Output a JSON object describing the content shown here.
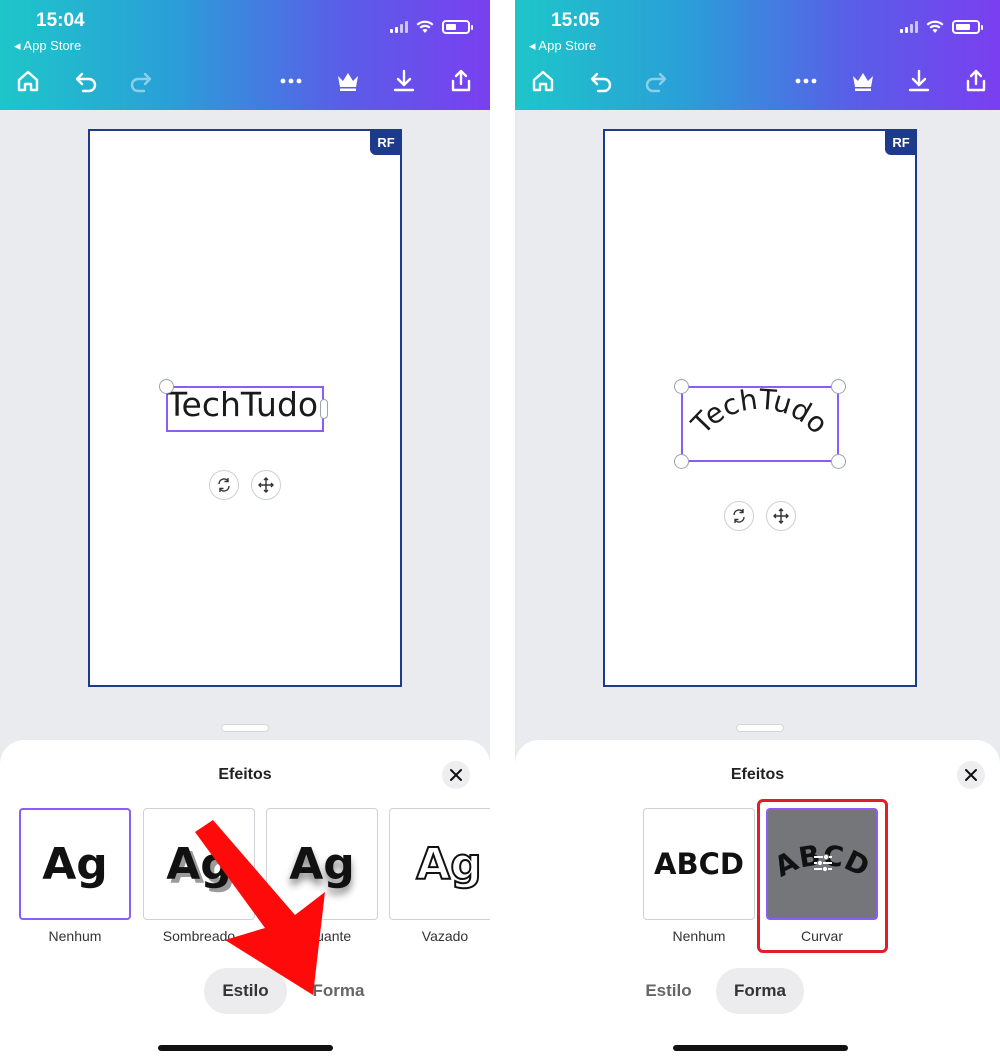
{
  "left": {
    "status": {
      "time": "15:04",
      "back_app": "App Store"
    },
    "canvas": {
      "badge": "RF",
      "text": "TechTudo"
    },
    "sheet": {
      "title": "Efeitos",
      "effects": [
        {
          "preview": "Ag",
          "label": "Nenhum"
        },
        {
          "preview": "Ag",
          "label": "Sombreado"
        },
        {
          "preview": "Ag",
          "label": "Flutuante"
        },
        {
          "preview": "Ag",
          "label": "Vazado"
        }
      ],
      "tabs": [
        {
          "label": "Estilo",
          "active": true
        },
        {
          "label": "Forma",
          "active": false
        }
      ]
    }
  },
  "right": {
    "status": {
      "time": "15:05",
      "back_app": "App Store"
    },
    "canvas": {
      "badge": "RF",
      "text": "TechTudo"
    },
    "sheet": {
      "title": "Efeitos",
      "effects": [
        {
          "preview": "ABCD",
          "label": "Nenhum"
        },
        {
          "preview": "ABCD",
          "label": "Curvar"
        }
      ],
      "tabs": [
        {
          "label": "Estilo",
          "active": false
        },
        {
          "label": "Forma",
          "active": true
        }
      ]
    }
  },
  "icons": [
    "home-icon",
    "undo-icon",
    "redo-icon",
    "more-icon",
    "crown-icon",
    "download-icon",
    "share-icon",
    "rotate-icon",
    "move-icon",
    "close-icon",
    "adjust-icon"
  ],
  "colors": {
    "accent": "#8b5cf6",
    "page_border": "#1e3a8a",
    "highlight": "#e11d2a"
  }
}
